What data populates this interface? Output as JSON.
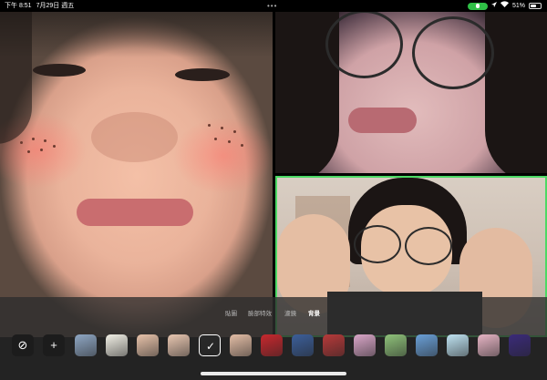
{
  "status_bar": {
    "time": "下午 8:51",
    "date": "7月29日 週五",
    "dots": "•••",
    "mic_indicator_label": "",
    "battery_percent": "51%",
    "battery_level": 0.51
  },
  "video_tiles": [
    {
      "name": "participant-main"
    },
    {
      "name": "participant-top-right"
    },
    {
      "name": "participant-self"
    }
  ],
  "effects_panel": {
    "tabs": [
      {
        "label": "貼圖",
        "active": false
      },
      {
        "label": "臉部特效",
        "active": false
      },
      {
        "label": "濾鏡",
        "active": false
      },
      {
        "label": "背景",
        "active": true
      }
    ],
    "none_icon": "⊘",
    "add_icon": "+",
    "thumbnails": [
      {
        "name": "blur",
        "color": "#8fa7c4",
        "selected": false
      },
      {
        "name": "list-doc",
        "color": "#f2f0e6",
        "selected": false
      },
      {
        "name": "face-1",
        "color": "#e8c3aa",
        "selected": false
      },
      {
        "name": "face-2",
        "color": "#e9c7b1",
        "selected": false
      },
      {
        "name": "face-dark",
        "color": "#2a2a2a",
        "selected": true
      },
      {
        "name": "face-3",
        "color": "#e4bea6",
        "selected": false
      },
      {
        "name": "red-creature",
        "color": "#c8282e",
        "selected": false
      },
      {
        "name": "sea-scene",
        "color": "#3c5f9a",
        "selected": false
      },
      {
        "name": "red-scene",
        "color": "#b73a3a",
        "selected": false
      },
      {
        "name": "pink-landscape",
        "color": "#d9a6c8",
        "selected": false
      },
      {
        "name": "green-hills",
        "color": "#8fc27a",
        "selected": false
      },
      {
        "name": "cartoon-scene",
        "color": "#6aa0d8",
        "selected": false
      },
      {
        "name": "sky-ice",
        "color": "#bfe3f2",
        "selected": false
      },
      {
        "name": "pink-girl",
        "color": "#e7b5c5",
        "selected": false
      },
      {
        "name": "purple-night",
        "color": "#3b2b7a",
        "selected": false
      }
    ],
    "check_icon": "✓"
  }
}
